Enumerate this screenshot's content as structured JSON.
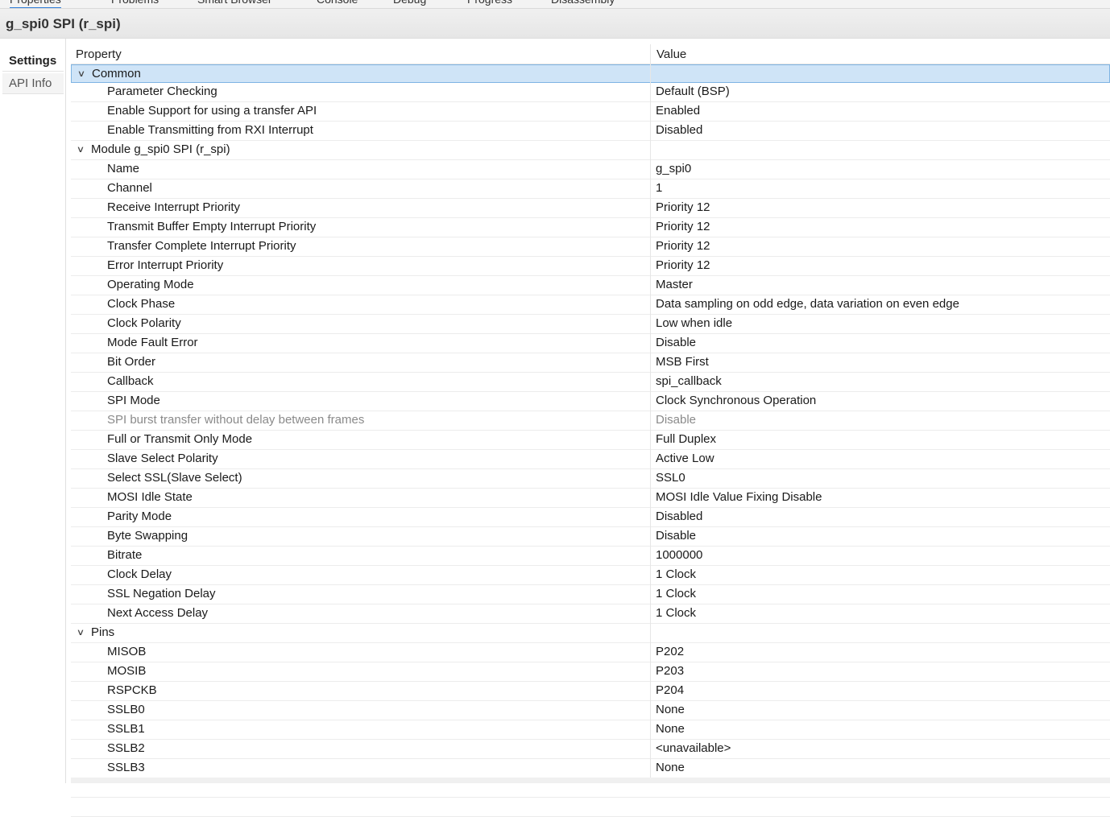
{
  "tabs": [
    {
      "label": "Properties",
      "active": true
    },
    {
      "label": "Problems"
    },
    {
      "label": "Smart Browser"
    },
    {
      "label": "Console"
    },
    {
      "label": "Debug"
    },
    {
      "label": "Progress"
    },
    {
      "label": "Disassembly"
    }
  ],
  "title": "g_spi0 SPI (r_spi)",
  "left_nav": {
    "settings": "Settings",
    "api_info": "API Info"
  },
  "table": {
    "header_property": "Property",
    "header_value": "Value",
    "rows": [
      {
        "type": "group",
        "name": "Common",
        "value": "",
        "selected": true
      },
      {
        "type": "prop",
        "name": "Parameter Checking",
        "value": "Default (BSP)"
      },
      {
        "type": "prop",
        "name": "Enable Support for using a transfer API",
        "value": "Enabled"
      },
      {
        "type": "prop",
        "name": "Enable Transmitting from RXI Interrupt",
        "value": "Disabled"
      },
      {
        "type": "group",
        "name": "Module g_spi0 SPI (r_spi)",
        "value": ""
      },
      {
        "type": "prop",
        "name": "Name",
        "value": "g_spi0"
      },
      {
        "type": "prop",
        "name": "Channel",
        "value": "1"
      },
      {
        "type": "prop",
        "name": "Receive Interrupt Priority",
        "value": "Priority 12"
      },
      {
        "type": "prop",
        "name": "Transmit Buffer Empty Interrupt Priority",
        "value": "Priority 12"
      },
      {
        "type": "prop",
        "name": "Transfer Complete Interrupt Priority",
        "value": "Priority 12"
      },
      {
        "type": "prop",
        "name": "Error Interrupt Priority",
        "value": "Priority 12"
      },
      {
        "type": "prop",
        "name": "Operating Mode",
        "value": "Master"
      },
      {
        "type": "prop",
        "name": "Clock Phase",
        "value": "Data sampling on odd edge, data variation on even edge"
      },
      {
        "type": "prop",
        "name": "Clock Polarity",
        "value": "Low when idle"
      },
      {
        "type": "prop",
        "name": "Mode Fault Error",
        "value": "Disable"
      },
      {
        "type": "prop",
        "name": "Bit Order",
        "value": "MSB First"
      },
      {
        "type": "prop",
        "name": "Callback",
        "value": "spi_callback"
      },
      {
        "type": "prop",
        "name": "SPI Mode",
        "value": "Clock Synchronous Operation"
      },
      {
        "type": "prop",
        "name": "SPI burst transfer without delay between frames",
        "value": "Disable",
        "disabled": true
      },
      {
        "type": "prop",
        "name": "Full or Transmit Only Mode",
        "value": "Full Duplex"
      },
      {
        "type": "prop",
        "name": "Slave Select Polarity",
        "value": "Active Low"
      },
      {
        "type": "prop",
        "name": "Select SSL(Slave Select)",
        "value": "SSL0"
      },
      {
        "type": "prop",
        "name": "MOSI Idle State",
        "value": "MOSI Idle Value Fixing Disable"
      },
      {
        "type": "prop",
        "name": "Parity Mode",
        "value": "Disabled"
      },
      {
        "type": "prop",
        "name": "Byte Swapping",
        "value": "Disable"
      },
      {
        "type": "prop",
        "name": "Bitrate",
        "value": "1000000"
      },
      {
        "type": "prop",
        "name": "Clock Delay",
        "value": "1 Clock"
      },
      {
        "type": "prop",
        "name": "SSL Negation Delay",
        "value": "1 Clock"
      },
      {
        "type": "prop",
        "name": "Next Access Delay",
        "value": "1 Clock"
      },
      {
        "type": "group",
        "name": "Pins",
        "value": ""
      },
      {
        "type": "prop",
        "name": "MISOB",
        "value": "P202"
      },
      {
        "type": "prop",
        "name": "MOSIB",
        "value": "P203"
      },
      {
        "type": "prop",
        "name": "RSPCKB",
        "value": "P204"
      },
      {
        "type": "prop",
        "name": "SSLB0",
        "value": "None"
      },
      {
        "type": "prop",
        "name": "SSLB1",
        "value": "None"
      },
      {
        "type": "prop",
        "name": "SSLB2",
        "value": "<unavailable>"
      },
      {
        "type": "prop",
        "name": "SSLB3",
        "value": "None"
      },
      {
        "type": "empty",
        "name": "",
        "value": ""
      },
      {
        "type": "empty",
        "name": "",
        "value": ""
      }
    ]
  },
  "icons": {
    "group_expander": "chevron-down-icon"
  },
  "colors": {
    "selection": "#cfe4f7",
    "active_tab_underline": "#2f7ed8"
  }
}
